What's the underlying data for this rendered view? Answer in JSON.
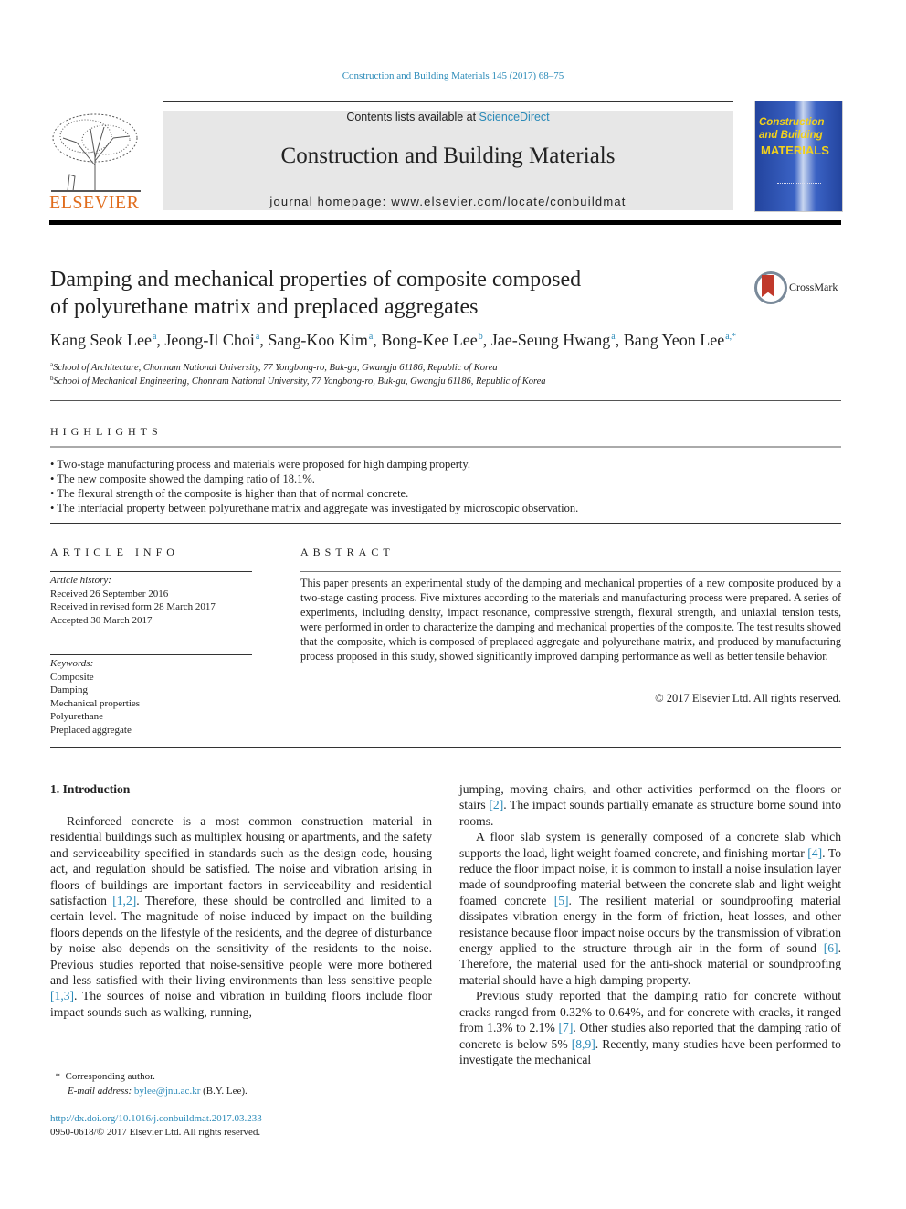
{
  "running_head": "Construction and Building Materials 145 (2017) 68–75",
  "banner": {
    "contents_prefix": "Contents lists available at ",
    "contents_link": "ScienceDirect",
    "journal_title": "Construction and Building Materials",
    "homepage_label": "journal homepage: www.elsevier.com/locate/conbuildmat"
  },
  "publisher_logo": "ELSEVIER",
  "cover": {
    "line1": "Construction",
    "line2": "and Building",
    "line3": "MATERIALS"
  },
  "crossmark_label": "CrossMark",
  "article": {
    "title_line1": "Damping and mechanical properties of composite composed",
    "title_line2": "of polyurethane matrix and preplaced aggregates",
    "authors": [
      {
        "name": "Kang Seok Lee",
        "sup": "a"
      },
      {
        "name": "Jeong-Il Choi",
        "sup": "a"
      },
      {
        "name": "Sang-Koo Kim",
        "sup": "a"
      },
      {
        "name": "Bong-Kee Lee",
        "sup": "b"
      },
      {
        "name": "Jae-Seung Hwang",
        "sup": "a"
      },
      {
        "name": "Bang Yeon Lee",
        "sup": "a,*"
      }
    ],
    "affiliations": [
      {
        "mark": "a",
        "text": "School of Architecture, Chonnam National University, 77 Yongbong-ro, Buk-gu, Gwangju 61186, Republic of Korea"
      },
      {
        "mark": "b",
        "text": "School of Mechanical Engineering, Chonnam National University, 77 Yongbong-ro, Buk-gu, Gwangju 61186, Republic of Korea"
      }
    ]
  },
  "highlights": {
    "heading": "HIGHLIGHTS",
    "items": [
      "Two-stage manufacturing process and materials were proposed for high damping property.",
      "The new composite showed the damping ratio of 18.1%.",
      "The flexural strength of the composite is higher than that of normal concrete.",
      "The interfacial property between polyurethane matrix and aggregate was investigated by microscopic observation."
    ]
  },
  "article_info": {
    "heading": "ARTICLE INFO",
    "history_label": "Article history:",
    "history": [
      "Received 26 September 2016",
      "Received in revised form 28 March 2017",
      "Accepted 30 March 2017"
    ],
    "keywords_label": "Keywords:",
    "keywords": [
      "Composite",
      "Damping",
      "Mechanical properties",
      "Polyurethane",
      "Preplaced aggregate"
    ]
  },
  "abstract": {
    "heading": "ABSTRACT",
    "text": "This paper presents an experimental study of the damping and mechanical properties of a new composite produced by a two-stage casting process. Five mixtures according to the materials and manufacturing process were prepared. A series of experiments, including density, impact resonance, compressive strength, flexural strength, and uniaxial tension tests, were performed in order to characterize the damping and mechanical properties of the composite. The test results showed that the composite, which is composed of preplaced aggregate and polyurethane matrix, and produced by manufacturing process proposed in this study, showed significantly improved damping performance as well as better tensile behavior.",
    "copyright": "© 2017 Elsevier Ltd. All rights reserved."
  },
  "introduction": {
    "heading": "1. Introduction",
    "left_p1_a": "Reinforced concrete is a most common construction material in residential buildings such as multiplex housing or apartments, and the safety and serviceability specified in standards such as the design code, housing act, and regulation should be satisfied. The noise and vibration arising in floors of buildings are important factors in serviceability and residential satisfaction ",
    "left_ref1": "[1,2]",
    "left_p1_b": ". Therefore, these should be controlled and limited to a certain level. The magnitude of noise induced by impact on the building floors depends on the lifestyle of the residents, and the degree of disturbance by noise also depends on the sensitivity of the residents to the noise. Previous studies reported that noise-sensitive people were more bothered and less satisfied with their living environments than less sensitive people ",
    "left_ref2": "[1,3]",
    "left_p1_c": ". The sources of noise and vibration in building floors include floor impact sounds such as walking, running,",
    "right_p1_a": "jumping, moving chairs, and other activities performed on the floors or stairs ",
    "right_ref1": "[2]",
    "right_p1_b": ". The impact sounds partially emanate as structure borne sound into rooms.",
    "right_p2_a": "A floor slab system is generally composed of a concrete slab which supports the load, light weight foamed concrete, and finishing mortar ",
    "right_ref2": "[4]",
    "right_p2_b": ". To reduce the floor impact noise, it is common to install a noise insulation layer made of soundproofing material between the concrete slab and light weight foamed concrete ",
    "right_ref3": "[5]",
    "right_p2_c": ". The resilient material or soundproofing material dissipates vibration energy in the form of friction, heat losses, and other resistance because floor impact noise occurs by the transmission of vibration energy applied to the structure through air in the form of sound ",
    "right_ref4": "[6]",
    "right_p2_d": ". Therefore, the material used for the anti-shock material or soundproofing material should have a high damping property.",
    "right_p3_a": "Previous study reported that the damping ratio for concrete without cracks ranged from 0.32% to 0.64%, and for concrete with cracks, it ranged from 1.3% to 2.1% ",
    "right_ref5": "[7]",
    "right_p3_b": ". Other studies also reported that the damping ratio of concrete is below 5% ",
    "right_ref6": "[8,9]",
    "right_p3_c": ". Recently, many studies have been performed to investigate the mechanical"
  },
  "footnote": {
    "star": "*",
    "corresponding": "Corresponding author.",
    "email_label": "E-mail address:",
    "email": "bylee@jnu.ac.kr",
    "email_suffix": " (B.Y. Lee)."
  },
  "doi": {
    "link": "http://dx.doi.org/10.1016/j.conbuildmat.2017.03.233",
    "issn_line": "0950-0618/© 2017 Elsevier Ltd. All rights reserved."
  }
}
